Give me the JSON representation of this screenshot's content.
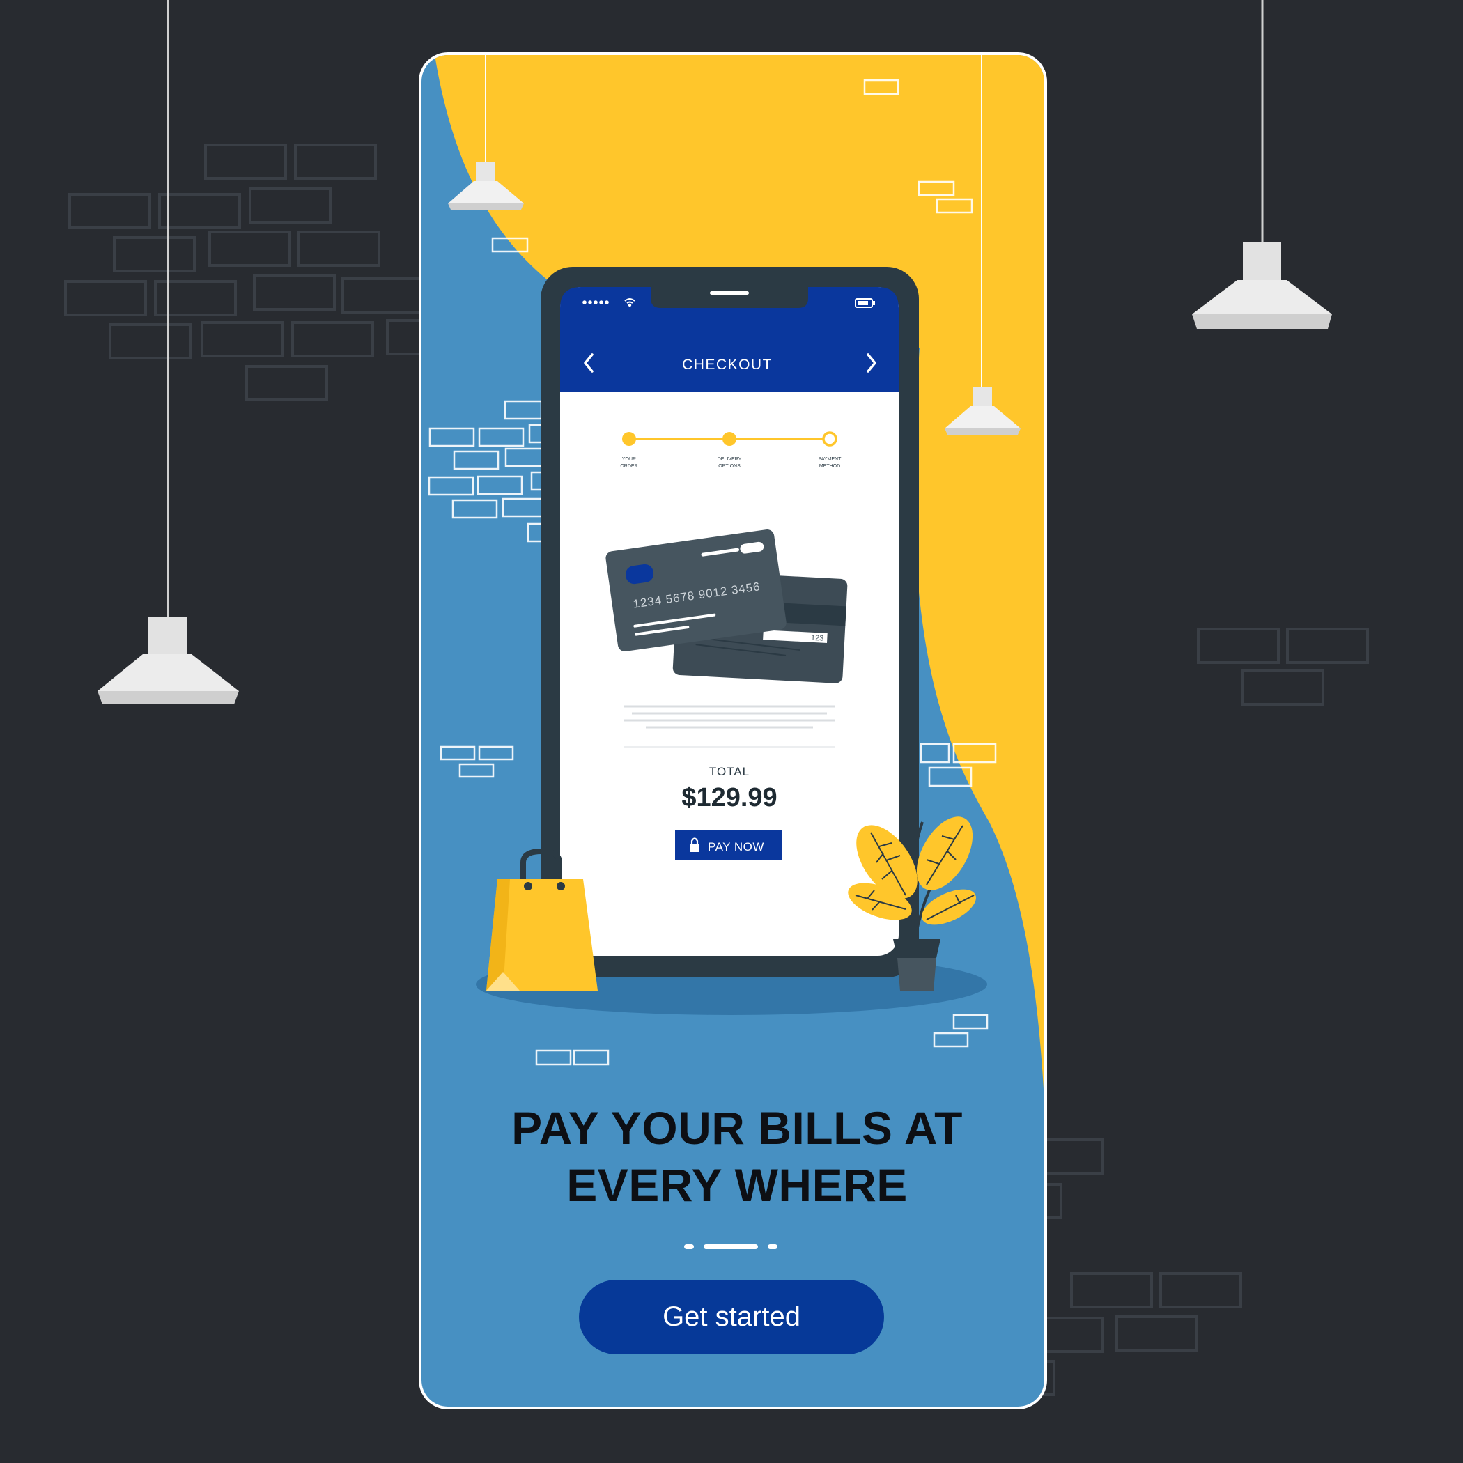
{
  "onboarding": {
    "headline_line1": "PAY YOUR BILLS AT",
    "headline_line2": "EVERY WHERE",
    "cta_label": "Get started",
    "pager": {
      "count": 3,
      "active_index": 1
    }
  },
  "phone_screen": {
    "title": "CHECKOUT",
    "steps": [
      {
        "label_line1": "YOUR",
        "label_line2": "ORDER",
        "state": "done"
      },
      {
        "label_line1": "DELIVERY",
        "label_line2": "OPTIONS",
        "state": "done"
      },
      {
        "label_line1": "PAYMENT",
        "label_line2": "METHOD",
        "state": "current"
      }
    ],
    "card_number": "1234 5678 9012 3456",
    "card_cvv": "123",
    "total_label": "TOTAL",
    "total_value": "$129.99",
    "pay_label": "PAY NOW"
  },
  "colors": {
    "background": "#282b30",
    "panel_blue": "#4790c2",
    "accent_yellow": "#ffc62b",
    "brand_navy": "#063998",
    "phone_body": "#2b3a44",
    "card_gray": "#46555f"
  },
  "icons": [
    "back-chevron-icon",
    "forward-chevron-icon",
    "signal-icon",
    "wifi-icon",
    "battery-icon",
    "lock-icon"
  ]
}
